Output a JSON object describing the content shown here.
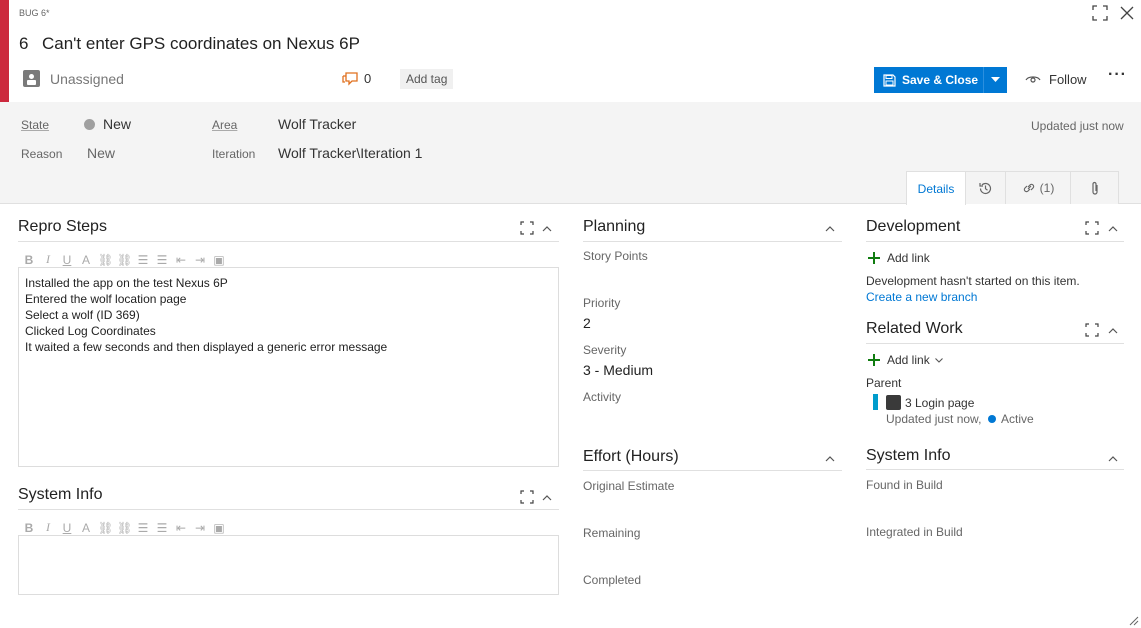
{
  "header": {
    "type_label": "BUG 6*",
    "id": "6",
    "title": "Can't enter GPS coordinates on Nexus 6P",
    "assignee": "Unassigned",
    "comment_count": "0",
    "add_tag": "Add tag",
    "save_close": "Save & Close",
    "follow": "Follow",
    "more": "···",
    "accent_color": "#cc293d",
    "brand_color": "#0078d4"
  },
  "meta": {
    "state_label": "State",
    "state_value": "New",
    "reason_label": "Reason",
    "reason_value": "New",
    "area_label": "Area",
    "area_value": "Wolf Tracker",
    "iteration_label": "Iteration",
    "iteration_value": "Wolf Tracker\\Iteration 1",
    "updated": "Updated just now"
  },
  "tabs": {
    "details": "Details",
    "history_icon": "history-icon",
    "links_count": "(1)",
    "attachments_icon": "paperclip-icon"
  },
  "repro": {
    "title": "Repro Steps",
    "lines": [
      "Installed the app on the test Nexus 6P",
      "Entered the wolf location page",
      "Select a wolf (ID 369)",
      "Clicked Log Coordinates",
      "It waited a few seconds and then displayed a generic error message"
    ]
  },
  "system_info_left": {
    "title": "System Info"
  },
  "planning": {
    "title": "Planning",
    "story_points_label": "Story Points",
    "priority_label": "Priority",
    "priority_value": "2",
    "severity_label": "Severity",
    "severity_value": "3 - Medium",
    "activity_label": "Activity"
  },
  "effort": {
    "title": "Effort (Hours)",
    "original_label": "Original Estimate",
    "remaining_label": "Remaining",
    "completed_label": "Completed"
  },
  "development": {
    "title": "Development",
    "add_link": "Add link",
    "status": "Development hasn't started on this item.",
    "create_branch": "Create a new branch"
  },
  "related": {
    "title": "Related Work",
    "add_link": "Add link",
    "parent_label": "Parent",
    "parent_item": "3 Login page",
    "parent_updated": "Updated just now,",
    "parent_state": "Active"
  },
  "system_info_right": {
    "title": "System Info",
    "found_label": "Found in Build",
    "integrated_label": "Integrated in Build"
  }
}
